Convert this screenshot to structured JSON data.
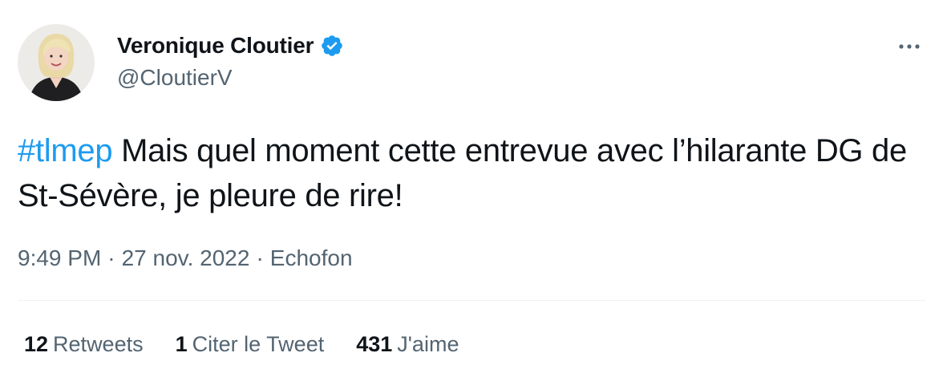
{
  "user": {
    "display_name": "Veronique Cloutier",
    "handle": "@CloutierV",
    "verified": true
  },
  "tweet": {
    "hashtag": "#tlmep",
    "text": " Mais quel moment cette entrevue avec l’hilarante DG de St-Sévère, je pleure de rire!"
  },
  "meta": {
    "time": "9:49 PM",
    "separator": "·",
    "date": "27 nov. 2022",
    "source": "Echofon"
  },
  "stats": {
    "retweets_count": "12",
    "retweets_label": "Retweets",
    "quotes_count": "1",
    "quotes_label": "Citer le Tweet",
    "likes_count": "431",
    "likes_label": "J'aime"
  },
  "icons": {
    "verified": "verified-badge-icon",
    "more": "more-options-icon"
  },
  "colors": {
    "accent": "#1d9bf0",
    "text_primary": "#0f1419",
    "text_secondary": "#536471",
    "divider": "#eff3f4"
  }
}
